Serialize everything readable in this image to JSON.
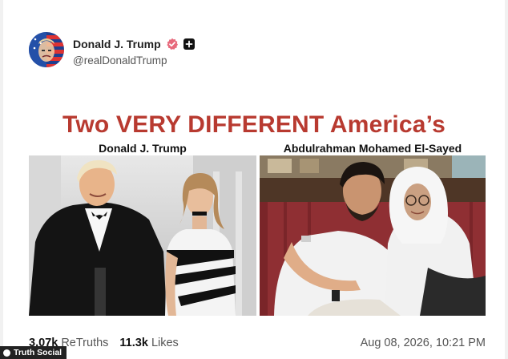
{
  "post": {
    "display_name": "Donald J. Trump",
    "handle": "@realDonaldTrump",
    "verified_icon": "verified-badge-icon",
    "plus_icon": "plus-badge-icon",
    "colors": {
      "headline": "#b83a30",
      "verified": "#e76a7c"
    }
  },
  "graphic": {
    "headline": "Two VERY DIFFERENT America’s",
    "left_caption": "Donald J. Trump",
    "right_caption": "Abdulrahman Mohamed El-Sayed"
  },
  "stats": {
    "retruths_count": "3.07k",
    "retruths_label": "ReTruths",
    "likes_count": "11.3k",
    "likes_label": "Likes",
    "timestamp": "Aug 08, 2026, 10:21 PM"
  },
  "watermark": {
    "label": "Truth Social"
  }
}
